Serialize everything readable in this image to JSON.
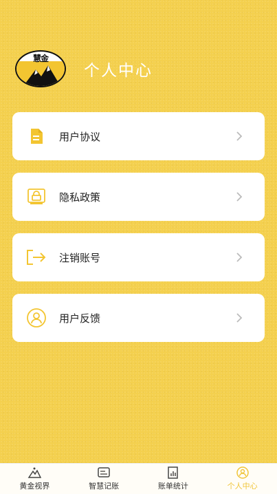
{
  "header": {
    "avatar_text": "慧金",
    "title": "个人中心"
  },
  "menu": {
    "items": [
      {
        "label": "用户协议",
        "icon": "document-icon"
      },
      {
        "label": "隐私政策",
        "icon": "lock-icon"
      },
      {
        "label": "注销账号",
        "icon": "logout-icon"
      },
      {
        "label": "用户反馈",
        "icon": "user-feedback-icon"
      }
    ]
  },
  "tabbar": {
    "items": [
      {
        "label": "黄金视界",
        "icon": "mountain-icon"
      },
      {
        "label": "智慧记账",
        "icon": "ledger-icon"
      },
      {
        "label": "账单统计",
        "icon": "bill-stats-icon"
      },
      {
        "label": "个人中心",
        "icon": "profile-icon",
        "active": true
      }
    ]
  },
  "colors": {
    "background": "#f4d04e",
    "accent": "#f0c53a"
  }
}
